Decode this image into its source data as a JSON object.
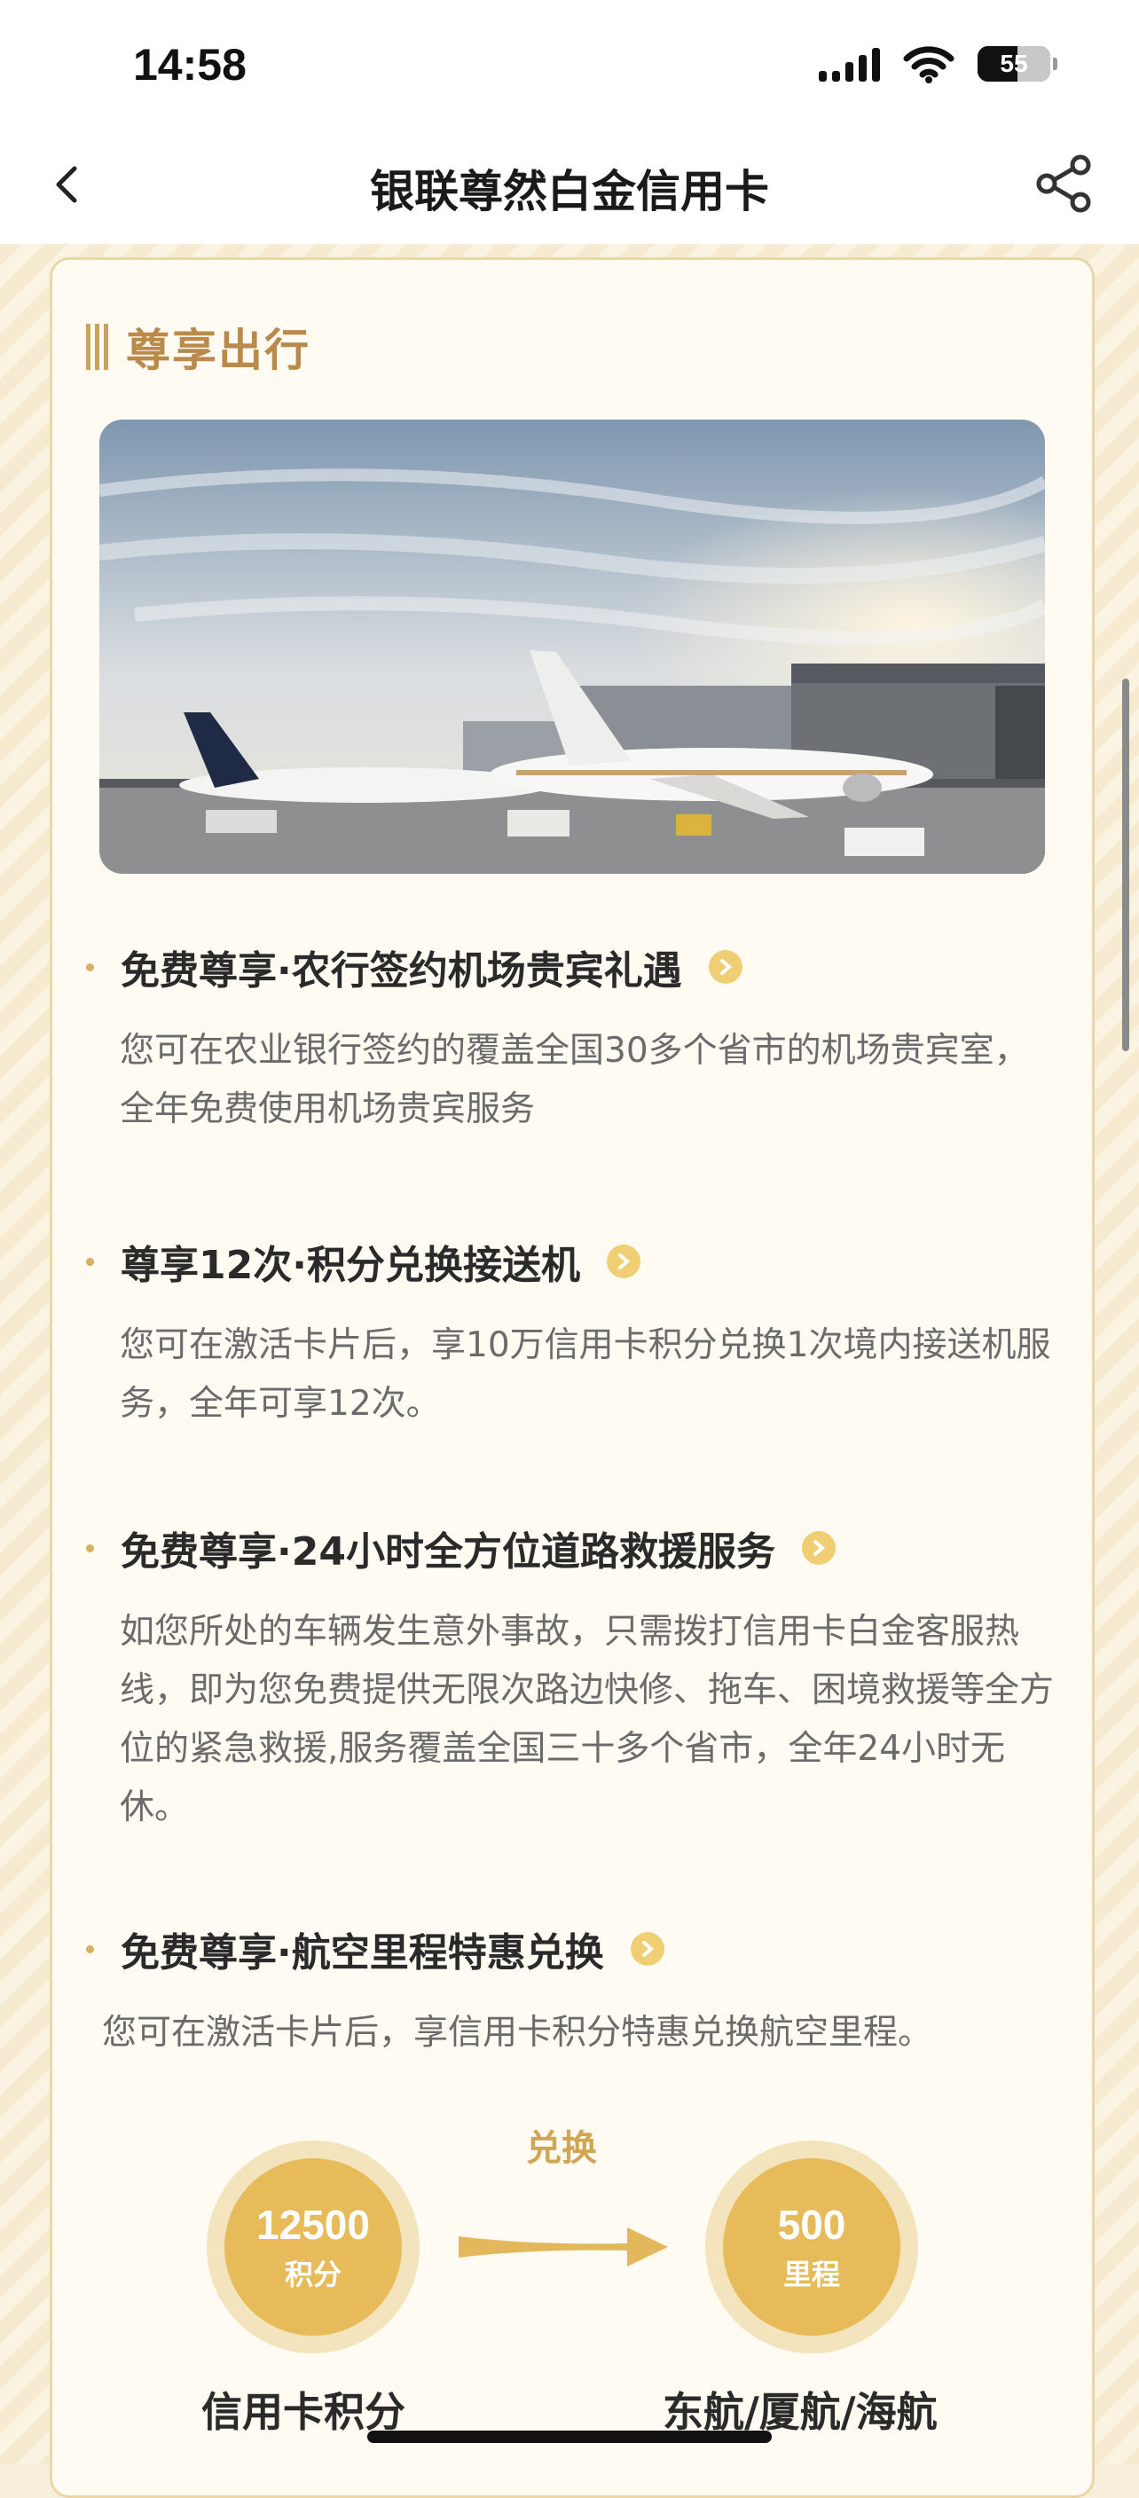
{
  "status": {
    "time": "14:58",
    "battery": "55"
  },
  "nav": {
    "title": "银联尊然白金信用卡"
  },
  "section": {
    "title": "尊享出行"
  },
  "items": [
    {
      "title": "免费尊享·农行签约机场贵宾礼遇",
      "desc": "您可在农业银行签约的覆盖全国30多个省市的机场贵宾室，全年免费使用机场贵宾服务"
    },
    {
      "title": "尊享12次·积分兑换接送机",
      "desc": "您可在激活卡片后，享10万信用卡积分兑换1次境内接送机服务，全年可享12次。"
    },
    {
      "title": "免费尊享·24小时全方位道路救援服务",
      "desc": "如您所处的车辆发生意外事故，只需拨打信用卡白金客服热线，即为您免费提供无限次路边快修、拖车、困境救援等全方位的紧急救援,服务覆盖全国三十多个省市，全年24小时无休。"
    },
    {
      "title": "免费尊享·航空里程特惠兑换",
      "desc": "您可在激活卡片后，享信用卡积分特惠兑换航空里程。"
    }
  ],
  "exchange": {
    "label": "兑换",
    "from": {
      "value": "12500",
      "unit": "积分",
      "caption": "信用卡积分"
    },
    "to": {
      "value": "500",
      "unit": "里程",
      "caption": "东航/厦航/海航"
    }
  }
}
